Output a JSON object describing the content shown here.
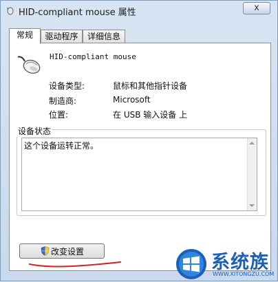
{
  "window": {
    "title": "HID-compliant mouse 属性",
    "close_label": "x"
  },
  "tabs": [
    {
      "label": "常规",
      "active": true
    },
    {
      "label": "驱动程序",
      "active": false
    },
    {
      "label": "详细信息",
      "active": false
    }
  ],
  "device": {
    "name": "HID-compliant mouse",
    "icon": "mouse-icon"
  },
  "properties": [
    {
      "label": "设备类型:",
      "value": "鼠标和其他指针设备"
    },
    {
      "label": "制造商:",
      "value": "Microsoft"
    },
    {
      "label": "位置:",
      "value": "在 USB 输入设备 上"
    }
  ],
  "status": {
    "legend": "设备状态",
    "text": "这个设备运转正常。"
  },
  "change_button": {
    "label": "改变设置",
    "icon": "shield-icon"
  },
  "watermark": {
    "brand": "系统族",
    "url": "WWW.XITONGZU.COM"
  },
  "colors": {
    "annotation": "#d62020",
    "watermark": "#1d5fb4"
  }
}
